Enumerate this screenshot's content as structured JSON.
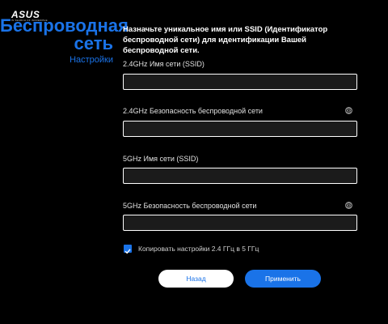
{
  "brand": {
    "logo": "ASUS",
    "tagline": "IN SEARCH OF INCREDIBLE"
  },
  "sidebar": {
    "title": "Беспроводная сеть",
    "subtitle": "Настройки"
  },
  "intro": "Назначьте уникальное имя или SSID (Идентификатор беспроводной сети) для идентификации Вашей беспроводной сети.",
  "fields": [
    {
      "label": "2.4GHz Имя сети (SSID)",
      "value": "",
      "has_eye": false
    },
    {
      "label": "2.4GHz Безопасность беспроводной сети",
      "value": "",
      "has_eye": true
    },
    {
      "label": "5GHz Имя сети (SSID)",
      "value": "",
      "has_eye": false
    },
    {
      "label": "5GHz Безопасность беспроводной сети",
      "value": "",
      "has_eye": true
    }
  ],
  "copy_checkbox": {
    "label": "Копировать настройки 2.4 ГГц в 5 ГГц",
    "checked": true
  },
  "buttons": {
    "back": "Назад",
    "apply": "Применить"
  },
  "colors": {
    "accent": "#1a73e8",
    "background": "#000000",
    "input_bg": "#1b1b1b",
    "eye_icon": "#8a8a8a"
  }
}
